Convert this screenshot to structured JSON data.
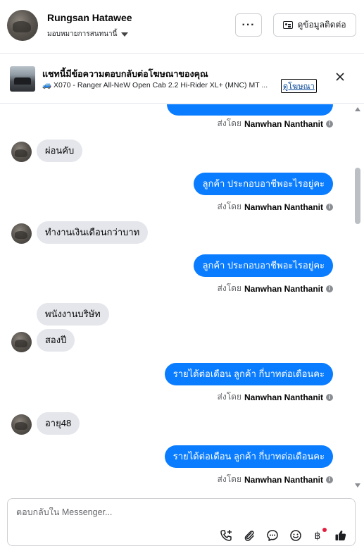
{
  "header": {
    "user_name": "Rungsan Hatawee",
    "assign_label": "มอบหมายการสนทนานี้",
    "more_label": "···",
    "contact_label": "ดูข้อมูลติดต่อ"
  },
  "ad_banner": {
    "title": "แชทนี้มีข้อความตอบกลับต่อโฆษณาของคุณ",
    "subtitle": "🚙 X070 - Ranger All-NeW Open Cab 2.2 Hi-Rider XL+ (MNC) MT ...",
    "link_label": "ดูโฆษณา"
  },
  "messages": [
    {
      "dir": "out",
      "text": "",
      "partial": true
    },
    {
      "dir": "in",
      "text": "ผ่อนคับ"
    },
    {
      "dir": "out",
      "text": "ลูกค้า ประกอบอาชีพอะไรอยู่คะ"
    },
    {
      "dir": "in",
      "text": "ทำงานเงินเดือนกว่าบาท"
    },
    {
      "dir": "out",
      "text": "ลูกค้า ประกอบอาชีพอะไรอยู่คะ"
    },
    {
      "dir": "in",
      "text": "พนังงานบริษัท"
    },
    {
      "dir": "in",
      "text": "สองปี"
    },
    {
      "dir": "out",
      "text": "รายได้ต่อเดือน ลูกค้า กี่บาทต่อเดือนคะ"
    },
    {
      "dir": "in",
      "text": "อายุ48"
    },
    {
      "dir": "out",
      "text": "รายได้ต่อเดือน ลูกค้า กี่บาทต่อเดือนคะ"
    }
  ],
  "sent_by": {
    "prefix": "ส่งโดย",
    "name": "Nanwhan Nanthanit"
  },
  "composer": {
    "placeholder": "ตอบกลับใน Messenger...",
    "value": ""
  },
  "icons": {
    "call": "phone-plus-icon",
    "attach": "paperclip-icon",
    "saved_replies": "chat-bubble-icon",
    "emoji": "emoji-icon",
    "payment": "baht-icon",
    "like": "thumbs-up-icon"
  },
  "colors": {
    "outgoing_bubble": "#0a7cff",
    "incoming_bubble": "#e4e6eb",
    "notification_dot": "#e41e3f"
  }
}
